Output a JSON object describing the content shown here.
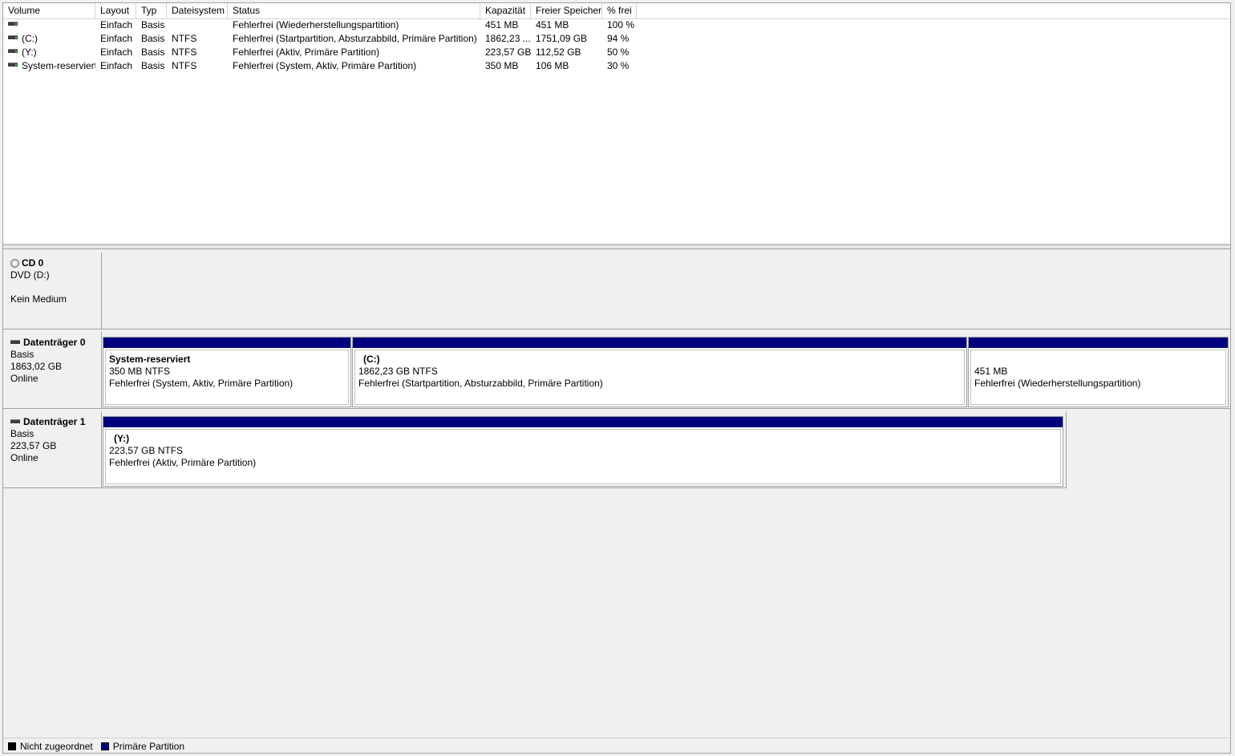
{
  "columns": [
    "Volume",
    "Layout",
    "Typ",
    "Dateisystem",
    "Status",
    "Kapazität",
    "Freier Speicher",
    "% frei"
  ],
  "volumes": [
    {
      "volume": "",
      "layout": "Einfach",
      "typ": "Basis",
      "fs": "",
      "status": "Fehlerfrei (Wiederherstellungspartition)",
      "kapazitaet": "451 MB",
      "frei": "451 MB",
      "prozent": "100 %"
    },
    {
      "volume": "(C:)",
      "layout": "Einfach",
      "typ": "Basis",
      "fs": "NTFS",
      "status": "Fehlerfrei (Startpartition, Absturzabbild, Primäre Partition)",
      "kapazitaet": "1862,23 ...",
      "frei": "1751,09 GB",
      "prozent": "94 %"
    },
    {
      "volume": "(Y:)",
      "layout": "Einfach",
      "typ": "Basis",
      "fs": "NTFS",
      "status": "Fehlerfrei (Aktiv, Primäre Partition)",
      "kapazitaet": "223,57 GB",
      "frei": "112,52 GB",
      "prozent": "50 %"
    },
    {
      "volume": "System-reserviert",
      "layout": "Einfach",
      "typ": "Basis",
      "fs": "NTFS",
      "status": "Fehlerfrei (System, Aktiv, Primäre Partition)",
      "kapazitaet": "350 MB",
      "frei": "106 MB",
      "prozent": "30 %"
    }
  ],
  "disks": [
    {
      "title": "CD 0",
      "icon": "cd-icon",
      "line1": "DVD (D:)",
      "line2": "",
      "line3": "Kein Medium",
      "partitions": []
    },
    {
      "title": "Datenträger 0",
      "icon": "disk-icon",
      "line1": "Basis",
      "line2": "1863,02 GB",
      "line3": "Online",
      "partitions": [
        {
          "name": "System-reserviert",
          "size": "350 MB NTFS",
          "status": "Fehlerfrei (System, Aktiv, Primäre Partition)"
        },
        {
          "name": "(C:)",
          "size": "1862,23 GB NTFS",
          "status": "Fehlerfrei (Startpartition, Absturzabbild, Primäre Partition)"
        },
        {
          "name": "",
          "size": "451 MB",
          "status": "Fehlerfrei (Wiederherstellungspartition)"
        }
      ]
    },
    {
      "title": "Datenträger 1",
      "icon": "disk-icon",
      "line1": "Basis",
      "line2": "223,57 GB",
      "line3": "Online",
      "partitions": [
        {
          "name": "(Y:)",
          "size": "223,57 GB NTFS",
          "status": "Fehlerfrei (Aktiv, Primäre Partition)"
        }
      ]
    }
  ],
  "legend": [
    {
      "label": "Nicht zugeordnet",
      "color": "#000000"
    },
    {
      "label": "Primäre Partition",
      "color": "#00007f"
    }
  ]
}
